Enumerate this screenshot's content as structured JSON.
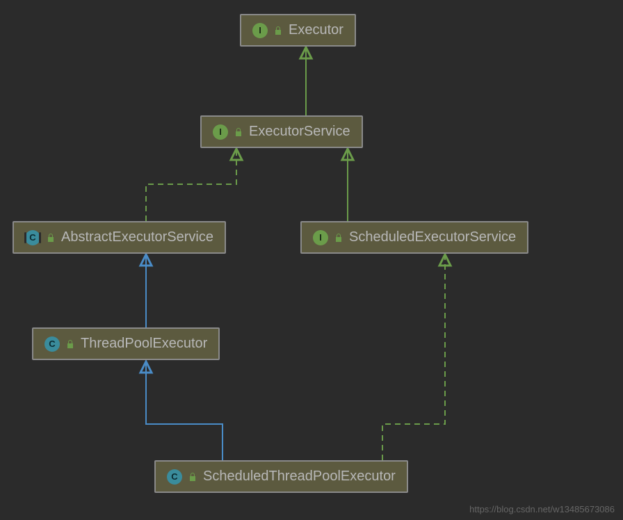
{
  "nodes": {
    "executor": {
      "label": "Executor",
      "type": "interface"
    },
    "executorService": {
      "label": "ExecutorService",
      "type": "interface"
    },
    "abstractExecutorService": {
      "label": "AbstractExecutorService",
      "type": "abstract-class"
    },
    "scheduledExecutorService": {
      "label": "ScheduledExecutorService",
      "type": "interface"
    },
    "threadPoolExecutor": {
      "label": "ThreadPoolExecutor",
      "type": "class"
    },
    "scheduledThreadPoolExecutor": {
      "label": "ScheduledThreadPoolExecutor",
      "type": "class"
    }
  },
  "badges": {
    "interface": "I",
    "class": "C",
    "abstract-class": "C"
  },
  "watermark": "https://blog.csdn.net/w13485673086",
  "edges": [
    {
      "from": "executorService",
      "to": "executor",
      "style": "solid",
      "color": "green"
    },
    {
      "from": "abstractExecutorService",
      "to": "executorService",
      "style": "dashed",
      "color": "green"
    },
    {
      "from": "scheduledExecutorService",
      "to": "executorService",
      "style": "solid",
      "color": "green"
    },
    {
      "from": "threadPoolExecutor",
      "to": "abstractExecutorService",
      "style": "solid",
      "color": "blue"
    },
    {
      "from": "scheduledThreadPoolExecutor",
      "to": "threadPoolExecutor",
      "style": "solid",
      "color": "blue"
    },
    {
      "from": "scheduledThreadPoolExecutor",
      "to": "scheduledExecutorService",
      "style": "dashed",
      "color": "green"
    }
  ]
}
